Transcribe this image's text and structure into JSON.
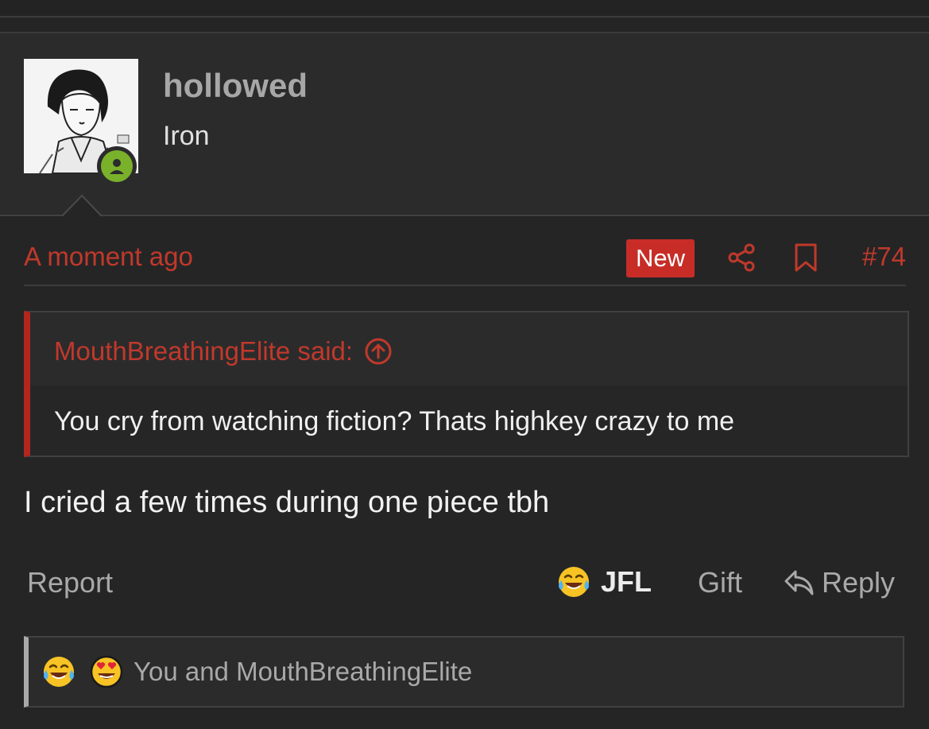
{
  "user": {
    "name": "hollowed",
    "title": "Iron",
    "avatar_alt": "",
    "status_color": "#7ab12b"
  },
  "post": {
    "time": "A moment ago",
    "badge": "New",
    "number": "#74",
    "quote": {
      "author_line": "MouthBreathingElite said:",
      "text": "You cry from watching fiction? Thats highkey crazy to me"
    },
    "message": "I cried a few times during one piece tbh",
    "actions": {
      "report": "Report",
      "reaction": "JFL",
      "gift": "Gift",
      "reply": "Reply"
    },
    "reactions_summary": "You and MouthBreathingElite"
  },
  "colors": {
    "accent": "#c0392b",
    "badge_bg": "#c72d26",
    "background": "#252526"
  },
  "icons": [
    "share-icon",
    "bookmark-icon",
    "arrow-up-circle-icon",
    "reply-icon",
    "laughing-tears-emoji",
    "heart-eyes-emoji",
    "user-status-icon"
  ]
}
